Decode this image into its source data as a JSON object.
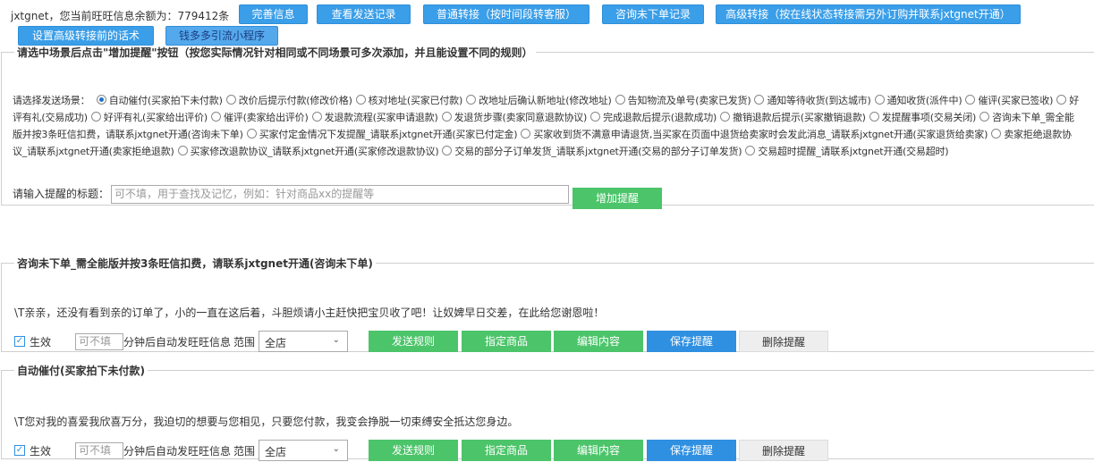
{
  "top": {
    "balance_label": "jxtgnet，您当前旺旺信息余额为：",
    "balance_value": "779412条",
    "buttons": [
      "完善信息",
      "查看发送记录",
      "普通转接（按时间段转客服）",
      "咨询未下单记录",
      "高级转接（按在线状态转接需另外订购并联系jxtgnet开通）",
      "设置高级转接前的话术",
      "钱多多引流小程序"
    ]
  },
  "add_panel": {
    "legend": "请选中场景后点击\"增加提醒\"按钮（按您实际情况针对相同或不同场景可多次添加，并且能设置不同的规则）",
    "scene_label": "请选择发送场景：",
    "scenes": [
      "自动催付(买家拍下未付款)",
      "改价后提示付款(修改价格)",
      "核对地址(买家已付款)",
      "改地址后确认新地址(修改地址)",
      "告知物流及单号(卖家已发货)",
      "通知等待收货(到达城市)",
      "通知收货(派件中)",
      "催评(买家已签收)",
      "好评有礼(交易成功)",
      "好评有礼(买家给出评价)",
      "催评(卖家给出评价)",
      "发退款流程(买家申请退款)",
      "发退货步骤(卖家同意退款协议)",
      "完成退款后提示(退款成功)",
      "撤销退款后提示(买家撤销退款)",
      "发提醒事项(交易关闭)",
      "咨询未下单_需全能版并按3条旺信扣费，请联系jxtgnet开通(咨询未下单)",
      "买家付定金情况下发提醒_请联系jxtgnet开通(买家已付定金)",
      "买家收到货不满意申请退货,当买家在页面中退货给卖家时会发此消息_请联系jxtgnet开通(买家退货给卖家)",
      "卖家拒绝退款协议_请联系jxtgnet开通(卖家拒绝退款)",
      "买家修改退款协议_请联系jxtgnet开通(买家修改退款协议)",
      "交易的部分子订单发货_请联系jxtgnet开通(交易的部分子订单发货)",
      "交易超时提醒_请联系jxtgnet开通(交易超时)"
    ],
    "selected_scene": 0,
    "title_label": "请输入提醒的标题：",
    "title_placeholder": "可不填，用于查找及记忆，例如：针对商品xx的提醒等",
    "add_button": "增加提醒"
  },
  "rules": [
    {
      "legend": "咨询未下单_需全能版并按3条旺信扣费，请联系jxtgnet开通(咨询未下单)",
      "message": "\\T亲亲，还没有看到亲的订单了，小的一直在这后着，斗胆烦请小主赶快把宝贝收了吧！让奴婢早日交差，在此给您谢恩啦！",
      "enabled_label": "生效",
      "minutes_placeholder": "可不填",
      "after_text": "分钟后自动发旺旺信息",
      "range_label": "范围",
      "range_value": "全店",
      "buttons": [
        "发送规则",
        "指定商品",
        "编辑内容",
        "保存提醒",
        "删除提醒"
      ]
    },
    {
      "legend": "自动催付(买家拍下未付款)",
      "message": "\\T您对我的喜爱我欣喜万分，我迫切的想要与您相见，只要您付款，我变会挣脱一切束缚安全抵达您身边。",
      "enabled_label": "生效",
      "minutes_placeholder": "可不填",
      "after_text": "分钟后自动发旺旺信息",
      "range_label": "范围",
      "range_value": "全店",
      "buttons": [
        "发送规则",
        "指定商品",
        "编辑内容",
        "保存提醒",
        "删除提醒"
      ]
    }
  ],
  "colors": {
    "blue": "#3a9ee8",
    "green": "#4cc46a",
    "save_blue": "#2f8fe0",
    "grey": "#eeeeee"
  }
}
